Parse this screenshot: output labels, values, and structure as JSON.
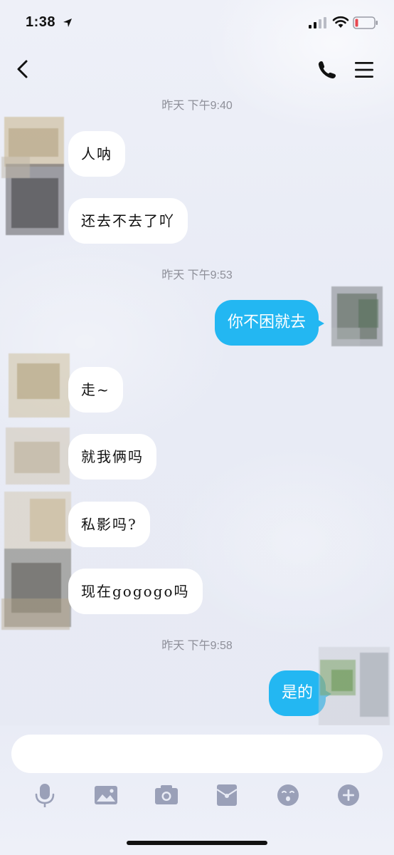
{
  "status_bar": {
    "time": "1:38",
    "icons": [
      "location-arrow-icon",
      "signal-icon",
      "wifi-icon",
      "battery-icon"
    ],
    "battery_color": "#e8474f"
  },
  "nav": {
    "icons": [
      "back-icon",
      "phone-icon",
      "menu-icon"
    ]
  },
  "colors": {
    "outgoing_bubble": "#23b7f2",
    "incoming_bubble": "#ffffff",
    "timestamp": "#8e8f99",
    "toolbar_icon": "#9aa0b8"
  },
  "messages": {
    "ts1": "昨天 下午9:40",
    "m1": "人呐",
    "m2": "还去不去了吖",
    "ts2": "昨天 下午9:53",
    "m3": "你不困就去",
    "m4": "走~",
    "m5": "就我俩吗",
    "m6": "私影吗?",
    "m7": "现在gogogo吗",
    "ts3": "昨天 下午9:58",
    "m8": "是的"
  },
  "input": {
    "placeholder": ""
  },
  "toolbar": {
    "icons": [
      "microphone-icon",
      "image-icon",
      "camera-icon",
      "red-packet-icon",
      "emoji-icon",
      "plus-icon"
    ]
  }
}
